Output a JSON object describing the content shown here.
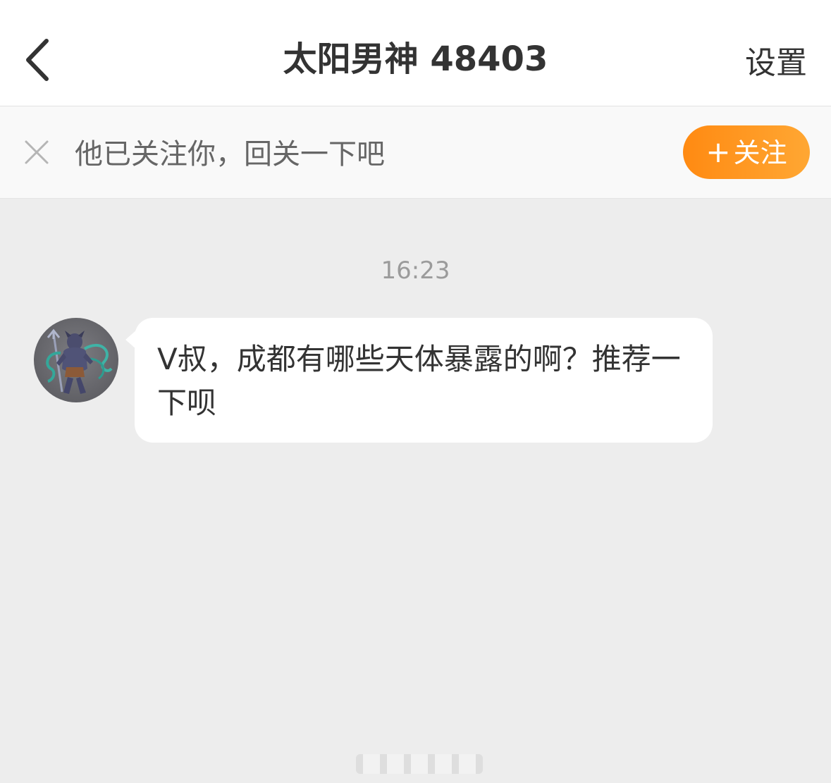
{
  "header": {
    "back_icon": "chevron-left-icon",
    "title": "太阳男神 48403",
    "settings_label": "设置"
  },
  "follow_bar": {
    "close_icon": "close-icon",
    "message": "他已关注你，回关一下吧",
    "follow_plus": "+",
    "follow_label": "关注",
    "accent_color": "#ff9a22"
  },
  "chat": {
    "timestamp": "16:23",
    "messages": [
      {
        "sender": "other",
        "avatar_icon": "avatar-demon-figure",
        "text": "V叔，成都有哪些天体暴露的啊？推荐一下呗"
      }
    ]
  },
  "colors": {
    "header_bg": "#ffffff",
    "chat_bg": "#ededed",
    "bubble_bg": "#ffffff",
    "text_primary": "#333333",
    "text_secondary": "#666666",
    "timestamp": "#9b9b9b"
  }
}
